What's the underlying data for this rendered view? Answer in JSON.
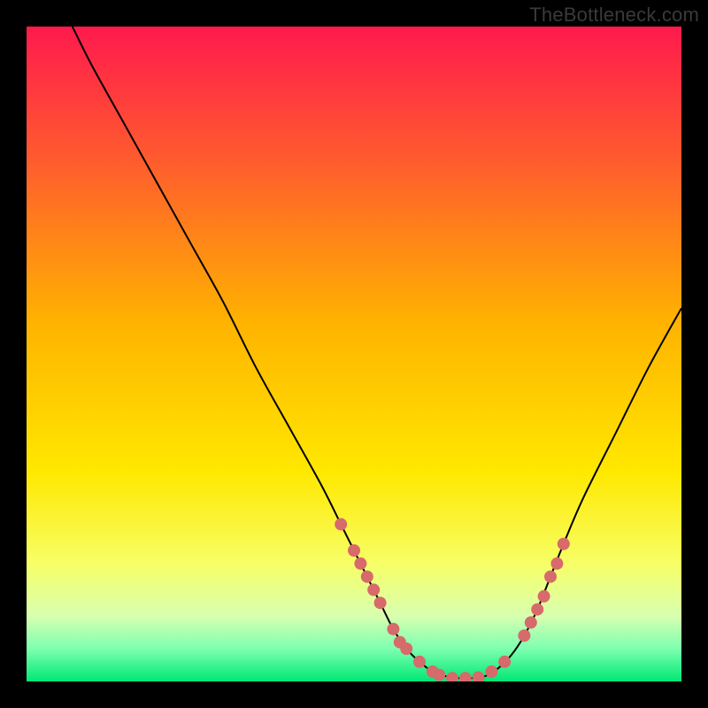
{
  "watermark": "TheBottleneck.com",
  "chart_data": {
    "type": "line",
    "title": "",
    "xlabel": "",
    "ylabel": "",
    "xlim": [
      0,
      100
    ],
    "ylim": [
      0,
      100
    ],
    "grid": false,
    "legend": false,
    "background_gradient": {
      "stops": [
        {
          "offset": 0.0,
          "color": "#ff1a4d"
        },
        {
          "offset": 0.2,
          "color": "#ff5a2f"
        },
        {
          "offset": 0.45,
          "color": "#ffb200"
        },
        {
          "offset": 0.68,
          "color": "#ffe800"
        },
        {
          "offset": 0.82,
          "color": "#f7ff66"
        },
        {
          "offset": 0.9,
          "color": "#d8ffb0"
        },
        {
          "offset": 0.95,
          "color": "#7dffb0"
        },
        {
          "offset": 1.0,
          "color": "#00e874"
        }
      ]
    },
    "series": [
      {
        "name": "bottleneck-curve",
        "color": "#000000",
        "x": [
          7,
          10,
          15,
          20,
          25,
          30,
          35,
          40,
          45,
          48,
          50,
          52,
          54,
          56,
          58,
          60,
          62,
          64,
          66,
          68,
          70,
          72,
          74,
          76,
          78,
          80,
          82,
          85,
          90,
          95,
          100
        ],
        "y": [
          100,
          94,
          85,
          76,
          67,
          58,
          48,
          39,
          30,
          24,
          20,
          16,
          12,
          8,
          5,
          3,
          1.5,
          0.8,
          0.5,
          0.5,
          0.8,
          2,
          4,
          7,
          11,
          16,
          21,
          28,
          38,
          48,
          57
        ]
      }
    ],
    "markers": {
      "name": "highlight-points",
      "color": "#d76a6a",
      "radius": 7,
      "points": [
        {
          "x": 48,
          "y": 24
        },
        {
          "x": 50,
          "y": 20
        },
        {
          "x": 51,
          "y": 18
        },
        {
          "x": 52,
          "y": 16
        },
        {
          "x": 53,
          "y": 14
        },
        {
          "x": 54,
          "y": 12
        },
        {
          "x": 56,
          "y": 8
        },
        {
          "x": 57,
          "y": 6
        },
        {
          "x": 58,
          "y": 5
        },
        {
          "x": 60,
          "y": 3
        },
        {
          "x": 62,
          "y": 1.5
        },
        {
          "x": 63,
          "y": 1.0
        },
        {
          "x": 65,
          "y": 0.5
        },
        {
          "x": 67,
          "y": 0.5
        },
        {
          "x": 69,
          "y": 0.6
        },
        {
          "x": 71,
          "y": 1.5
        },
        {
          "x": 73,
          "y": 3
        },
        {
          "x": 76,
          "y": 7
        },
        {
          "x": 77,
          "y": 9
        },
        {
          "x": 78,
          "y": 11
        },
        {
          "x": 79,
          "y": 13
        },
        {
          "x": 80,
          "y": 16
        },
        {
          "x": 81,
          "y": 18
        },
        {
          "x": 82,
          "y": 21
        }
      ]
    }
  }
}
